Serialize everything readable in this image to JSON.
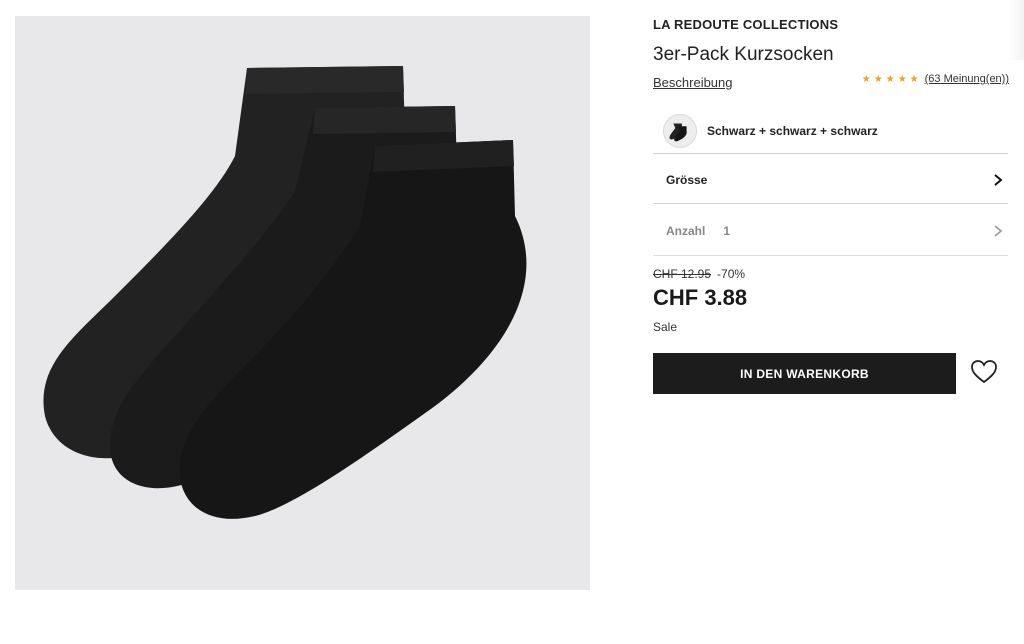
{
  "product": {
    "brand": "LA REDOUTE COLLECTIONS",
    "title": "3er-Pack Kurzsocken",
    "description_link": "Beschreibung",
    "rating_stars": "★★★★★",
    "rating_value": 5,
    "reviews_link": "(63 Meinung(en))",
    "image_icon": "socks-photo",
    "color": {
      "label": "Schwarz + schwarz + schwarz",
      "swatch_icon": "socks-swatch"
    },
    "size": {
      "label": "Grösse",
      "chevron_icon": "chevron-right-icon"
    },
    "quantity": {
      "label": "Anzahl",
      "value": "1",
      "chevron_icon": "chevron-right-icon"
    },
    "pricing": {
      "old_price": "CHF 12.95",
      "discount": "-70%",
      "price": "CHF 3.88",
      "badge": "Sale"
    },
    "add_to_cart_label": "IN DEN WARENKORB",
    "wishlist_icon": "heart-icon"
  },
  "colors": {
    "primary_button": "#1c1c1c",
    "star": "#f0a020",
    "image_background": "#e8e8ea"
  }
}
